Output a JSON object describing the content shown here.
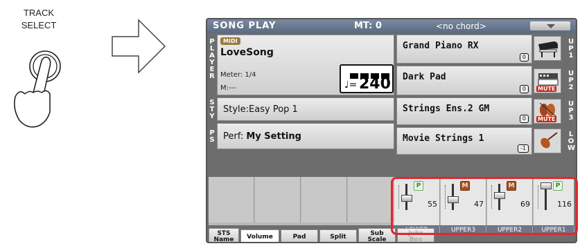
{
  "illustration": {
    "track_select_line1": "TRACK",
    "track_select_line2": "SELECT"
  },
  "header": {
    "mode": "SONG PLAY",
    "mt": "MT: 0",
    "chord": "<no chord>"
  },
  "side_labels": {
    "player": "PLAYER",
    "sty": "STY",
    "ps": "PS",
    "up1": "UP1",
    "up2": "UP2",
    "up3": "UP3",
    "low": "LOW"
  },
  "player": {
    "badge": "MIDI",
    "song": "LoveSong",
    "meter": "Meter: 1/4",
    "measure": "M:---",
    "tempo_note": "♩=",
    "tempo": "240"
  },
  "style": {
    "label": "Style:",
    "name": "Easy Pop 1"
  },
  "performance": {
    "label": "Perf:",
    "name": "My Setting"
  },
  "sounds": [
    {
      "name": "Grand Piano RX",
      "octave": "0",
      "icon": "piano-icon",
      "muted": false
    },
    {
      "name": "Dark Pad",
      "octave": "0",
      "icon": "synth-icon",
      "muted": true,
      "mute_label": "MUTE"
    },
    {
      "name": "Strings Ens.2 GM",
      "octave": "0",
      "icon": "strings-icon",
      "muted": true,
      "mute_label": "MUTE"
    },
    {
      "name": "Movie Strings 1",
      "octave": "-1",
      "icon": "violin-icon",
      "muted": false
    }
  ],
  "mixer": [
    {
      "channel": "LOWER",
      "play_state": "P",
      "volume": "55",
      "level": 0.43
    },
    {
      "channel": "UPPER3",
      "play_state": "M",
      "volume": "47",
      "level": 0.37
    },
    {
      "channel": "UPPER2",
      "play_state": "M",
      "volume": "69",
      "level": 0.54
    },
    {
      "channel": "UPPER1",
      "play_state": "P",
      "volume": "116",
      "level": 0.91
    }
  ],
  "tabs": [
    {
      "label": "STS\nName",
      "l1": "STS",
      "l2": "Name"
    },
    {
      "label": "Volume"
    },
    {
      "label": "Pad"
    },
    {
      "label": "Split"
    },
    {
      "label": "Sub Scale",
      "l1": "Sub",
      "l2": "Scale"
    },
    {
      "label": "Juke Box",
      "l1": "Juke",
      "l2": "Box",
      "disabled": true
    }
  ],
  "colors": {
    "highlight": "#e4262c",
    "mute": "#c02a1a",
    "titlebar": "#6b7a90"
  }
}
